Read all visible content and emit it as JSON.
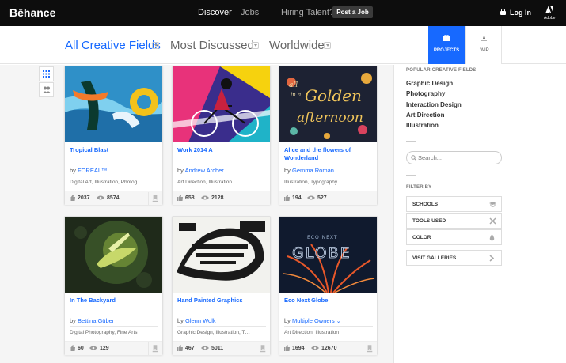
{
  "topbar": {
    "logo": "Bēhance",
    "nav": [
      "Discover",
      "Jobs",
      "Hiring Talent?"
    ],
    "post_job": "Post a Job",
    "login": "Log In",
    "adobe": "Adobe"
  },
  "filters": {
    "fields": "All Creative Fields",
    "sort": "Most Discussed",
    "location": "Worldwide"
  },
  "tabs": {
    "projects": "PROJECTS",
    "wip": "WIP"
  },
  "projects": [
    {
      "title": "Tropical Blast",
      "by": "by",
      "owner": "FOREAL™",
      "fields": "Digital Art, Illustration, Photog…",
      "appreciations": "2037",
      "views": "8574"
    },
    {
      "title": "Work 2014 A",
      "by": "by",
      "owner": "Andrew Archer",
      "fields": "Art Direction, Illustration",
      "appreciations": "658",
      "views": "2128"
    },
    {
      "title": "Alice and the flowers of Wonderland",
      "by": "by",
      "owner": "Gemma Román",
      "fields": "Illustration, Typography",
      "appreciations": "194",
      "views": "527"
    },
    {
      "title": "In The Backyard",
      "by": "by",
      "owner": "Bettina Güber",
      "fields": "Digital Photography, Fine Arts",
      "appreciations": "60",
      "views": "129"
    },
    {
      "title": "Hand Painted Graphics",
      "by": "by",
      "owner": "Glenn Wolk",
      "fields": "Graphic Design, Illustration, T…",
      "appreciations": "467",
      "views": "5011"
    },
    {
      "title": "Eco Next Globe",
      "by": "by",
      "owner": "Multiple Owners",
      "fields": "Art Direction, Illustration",
      "appreciations": "1694",
      "views": "12670"
    }
  ],
  "thumbnails": {
    "card3_line1": "all",
    "card3_line2": "in a",
    "card3_line3": "Golden",
    "card3_line4": "afternoon",
    "card6_line1": "ECO NEXT",
    "card6_line2": "GLOBE"
  },
  "sidebar": {
    "popular_heading": "POPULAR CREATIVE FIELDS",
    "popular_fields": [
      "Graphic Design",
      "Photography",
      "Interaction Design",
      "Art Direction",
      "Illustration"
    ],
    "search_placeholder": "Search...",
    "filter_heading": "FILTER BY",
    "filters": [
      "SCHOOLS",
      "TOOLS USED",
      "COLOR"
    ],
    "visit_galleries": "VISIT GALLERIES"
  },
  "colors": {
    "accent": "#1769ff",
    "topbar": "#0d0d0d"
  }
}
